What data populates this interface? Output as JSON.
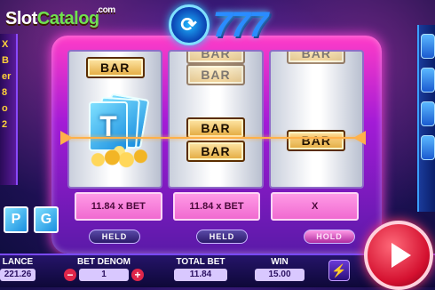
{
  "watermark": {
    "left": "Slot",
    "right": "Catalog",
    "suffix": ".com"
  },
  "logo": {
    "text": "777"
  },
  "side_left": [
    "X",
    "B",
    "er",
    "8",
    "o",
    "2"
  ],
  "reels": [
    {
      "symbols": [
        "BAR",
        "T",
        "none"
      ]
    },
    {
      "symbols": [
        "BAR",
        "BAR",
        "BAR",
        "BAR",
        "BAR"
      ]
    },
    {
      "symbols": [
        "BAR",
        "BAR",
        "none"
      ]
    }
  ],
  "bet_panels": [
    "11.84 x BET",
    "11.84 x BET",
    "X"
  ],
  "hold_buttons": [
    {
      "label": "HELD",
      "active": false
    },
    {
      "label": "HELD",
      "active": false
    },
    {
      "label": "HOLD",
      "active": true
    }
  ],
  "pg_tiles": [
    "P",
    "G"
  ],
  "bottom": {
    "balance_label": "LANCE",
    "balance_value": "221.26",
    "denom_label": "BET DENOM",
    "denom_value": "1",
    "total_bet_label": "TOTAL BET",
    "total_bet_value": "11.84",
    "win_label": "WIN",
    "win_value": "15.00"
  },
  "icons": {
    "spin": "play-icon",
    "bolt": "lightning-icon",
    "minus": "minus-icon",
    "plus": "plus-icon"
  },
  "colors": {
    "accent_pink": "#ff3cc8",
    "spin_red": "#d4102f",
    "win_line": "#ffb14a"
  }
}
